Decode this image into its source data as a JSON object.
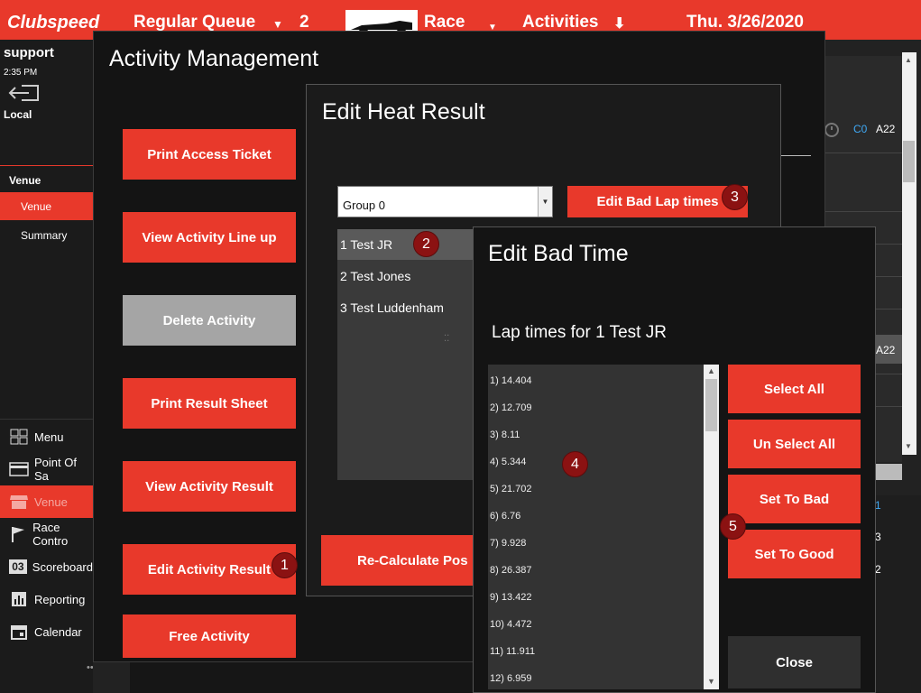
{
  "topbar": {
    "logo": "Clubspeed",
    "queue": "Regular Queue",
    "queue_count": "2",
    "race_label": "Race",
    "activities_label": "Activities",
    "date": "Thu. 3/26/2020"
  },
  "sidebar": {
    "user": "support",
    "time": "2:35 PM",
    "location": "Local",
    "section_header": "Venue",
    "subitems": [
      "Venue",
      "Summary"
    ],
    "items": [
      {
        "label": "Menu",
        "icon": "grid-icon"
      },
      {
        "label": "Point Of Sa",
        "icon": "card-icon"
      },
      {
        "label": "Venue",
        "icon": "store-icon"
      },
      {
        "label": "Race Contro",
        "icon": "flag-icon"
      },
      {
        "label": "Scoreboard",
        "icon": "scoreboard-icon"
      },
      {
        "label": "Reporting",
        "icon": "chart-icon"
      },
      {
        "label": "Calendar",
        "icon": "calendar-icon"
      }
    ],
    "more": "•••"
  },
  "background": {
    "c0": "C0",
    "a22_1": "A22",
    "a22_2": "A22",
    "digit_1": "1",
    "digit_3": "3",
    "digit_2": "2"
  },
  "activity_management": {
    "title": "Activity Management",
    "buttons": [
      "Print Access Ticket",
      "View Activity Line up",
      "Delete Activity",
      "Print Result Sheet",
      "View Activity Result",
      "Edit Activity Result",
      "Free Activity"
    ]
  },
  "edit_heat_result": {
    "title": "Edit Heat Result",
    "group_select": "Group 0",
    "edit_bad_laps_button": "Edit Bad Lap times",
    "racers": [
      "1 Test JR",
      "2 Test Jones",
      "3 Test Luddenham"
    ],
    "recalc_button": "Re-Calculate Pos"
  },
  "edit_bad_time": {
    "title": "Edit Bad Time",
    "subtitle": "Lap times for 1 Test JR",
    "laps": [
      "1) 14.404",
      "2) 12.709",
      "3) 8.11",
      "4) 5.344",
      "5) 21.702",
      "6) 6.76",
      "7) 9.928",
      "8) 26.387",
      "9) 13.422",
      "10) 4.472",
      "11) 11.911",
      "12) 6.959"
    ],
    "buttons": {
      "select_all": "Select All",
      "unselect_all": "Un Select All",
      "set_bad": "Set To Bad",
      "set_good": "Set To Good",
      "close": "Close"
    }
  },
  "badges": [
    "1",
    "2",
    "3",
    "4",
    "5"
  ],
  "colors": {
    "accent": "#e8392b",
    "badge": "#8b1212"
  }
}
